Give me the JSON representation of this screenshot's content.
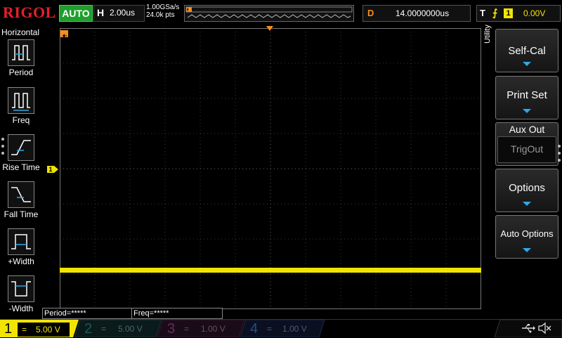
{
  "brand": "RIGOL",
  "run_status": "AUTO",
  "horizontal": {
    "letter": "H",
    "timebase": "2.00us"
  },
  "acquisition": {
    "sample_rate": "1.00GSa/s",
    "memory_depth": "24.0k pts"
  },
  "delay": {
    "letter": "D",
    "value": "14.0000000us"
  },
  "trigger": {
    "letter": "T",
    "edge_symbol": "⨍",
    "source": "1",
    "level": "0.00V"
  },
  "left_menu": {
    "title": "Horizontal",
    "items": [
      {
        "label": "Period",
        "icon": "period-icon"
      },
      {
        "label": "Freq",
        "icon": "frequency-icon"
      },
      {
        "label": "Rise Time",
        "icon": "rise-time-icon"
      },
      {
        "label": "Fall Time",
        "icon": "fall-time-icon"
      },
      {
        "label": "+Width",
        "icon": "positive-width-icon"
      },
      {
        "label": "-Width",
        "icon": "negative-width-icon"
      }
    ]
  },
  "measurements": [
    {
      "label": "Period=*****"
    },
    {
      "label": "Freq=*****"
    }
  ],
  "right_menu": {
    "title": "Utility",
    "buttons": [
      {
        "label": "Self-Cal",
        "has_arrow": true
      },
      {
        "label": "Print Set",
        "has_arrow": true
      },
      {
        "label": "Options",
        "has_arrow": true
      },
      {
        "label": "Auto Options",
        "has_arrow": true
      }
    ],
    "aux_out": {
      "title": "Aux Out",
      "value": "TrigOut"
    }
  },
  "channels": [
    {
      "num": "1",
      "coupling": "=",
      "scale": "5.00 V",
      "color": "#f2e400",
      "active": true
    },
    {
      "num": "2",
      "coupling": "=",
      "scale": "5.00 V",
      "color": "#00c8c8",
      "active": false
    },
    {
      "num": "3",
      "coupling": "=",
      "scale": "1.00 V",
      "color": "#e03cc8",
      "active": false
    },
    {
      "num": "4",
      "coupling": "=",
      "scale": "1.00 V",
      "color": "#1e78ff",
      "active": false
    }
  ],
  "waveform": {
    "channel": "1",
    "level_fraction": 0.86
  },
  "colors": {
    "accent": "#f2e400",
    "trigger_marker": "#f68e1e",
    "menu_arrow": "#2fa8e6",
    "brand": "#e5202c"
  },
  "status_icons": [
    "usb-icon",
    "speaker-muted-icon"
  ]
}
